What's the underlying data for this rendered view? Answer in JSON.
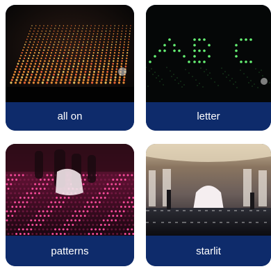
{
  "cards": [
    {
      "label": "all on",
      "icon": "led-grid-all-on-image"
    },
    {
      "label": "letter",
      "icon": "led-letter-display-image"
    },
    {
      "label": "patterns",
      "icon": "led-patterns-dance-floor-image"
    },
    {
      "label": "starlit",
      "icon": "starlit-ballroom-image"
    }
  ],
  "colors": {
    "label_background": "#0e2b6b",
    "label_text": "#ffffff"
  }
}
